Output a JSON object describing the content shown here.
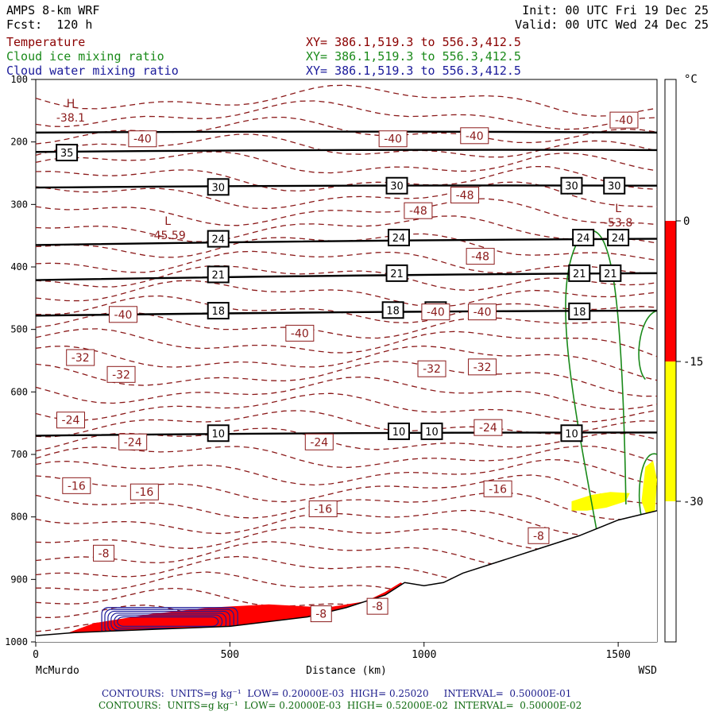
{
  "header": {
    "model": "AMPS 8-km WRF",
    "forecast": "Fcst:  120 h",
    "init": "Init: 00 UTC Fri 19 Dec 25",
    "valid": "Valid: 00 UTC Wed 24 Dec 25"
  },
  "fields": [
    {
      "name": "Temperature",
      "xy": "XY= 386.1,519.3 to 556.3,412.5",
      "color": "#8b0000"
    },
    {
      "name": "Cloud ice mixing ratio",
      "xy": "XY= 386.1,519.3 to 556.3,412.5",
      "color": "#1a8a1a"
    },
    {
      "name": "Cloud water mixing ratio",
      "xy": "XY= 386.1,519.3 to 556.3,412.5",
      "color": "#1a1a9a"
    }
  ],
  "footer": {
    "line1": "CONTOURS:  UNITS=g kg⁻¹  LOW= 0.20000E-03  HIGH= 0.25020     INTERVAL=  0.50000E-01",
    "line2": "CONTOURS:  UNITS=g kg⁻¹  LOW= 0.20000E-03  HIGH= 0.52000E-02  INTERVAL=  0.50000E-02"
  },
  "chart_data": {
    "type": "line",
    "xlabel": "Distance (km)",
    "xlim": [
      0,
      1600
    ],
    "xticks": [
      0,
      500,
      1000,
      1500
    ],
    "x_endpoints": {
      "left": "McMurdo",
      "right": "WSD"
    },
    "ylim": [
      1000,
      100
    ],
    "yticks": [
      100,
      200,
      300,
      400,
      500,
      600,
      700,
      800,
      900,
      1000
    ],
    "colorbar": {
      "unit": "°C",
      "ticks": [
        0,
        -15,
        -30
      ],
      "colors": {
        "above_0": "#ffffff",
        "0_to_-15": "#ff0000",
        "-15_to_-30": "#ffff00",
        "below_-30": "#ffffff"
      }
    },
    "theta_lines": [
      {
        "level": 35,
        "pressure_left": 185,
        "pressure_right": 185
      },
      {
        "level": 35,
        "pressure_left": 216,
        "pressure_right": 213
      },
      {
        "level": 30,
        "pressure_left": 273,
        "pressure_right": 270
      },
      {
        "level": 24,
        "pressure_left": 365,
        "pressure_right": 355
      },
      {
        "level": 21,
        "pressure_left": 421,
        "pressure_right": 410
      },
      {
        "level": 18,
        "pressure_left": 478,
        "pressure_right": 470
      },
      {
        "level": 10,
        "pressure_left": 670,
        "pressure_right": 665
      }
    ],
    "theta_labels": [
      {
        "text": "35",
        "x": 80,
        "p": 217
      },
      {
        "text": "30",
        "x": 470,
        "p": 272
      },
      {
        "text": "30",
        "x": 930,
        "p": 270
      },
      {
        "text": "30",
        "x": 1380,
        "p": 270
      },
      {
        "text": "30",
        "x": 1490,
        "p": 270
      },
      {
        "text": "24",
        "x": 470,
        "p": 355
      },
      {
        "text": "24",
        "x": 935,
        "p": 353
      },
      {
        "text": "24",
        "x": 1410,
        "p": 353
      },
      {
        "text": "24",
        "x": 1500,
        "p": 353
      },
      {
        "text": "21",
        "x": 470,
        "p": 412
      },
      {
        "text": "21",
        "x": 930,
        "p": 410
      },
      {
        "text": "21",
        "x": 1400,
        "p": 410
      },
      {
        "text": "21",
        "x": 1480,
        "p": 410
      },
      {
        "text": "18",
        "x": 470,
        "p": 470
      },
      {
        "text": "18",
        "x": 920,
        "p": 469
      },
      {
        "text": "18",
        "x": 1030,
        "p": 469
      },
      {
        "text": "18",
        "x": 1400,
        "p": 471
      },
      {
        "text": "10",
        "x": 470,
        "p": 666
      },
      {
        "text": "10",
        "x": 935,
        "p": 663
      },
      {
        "text": "10",
        "x": 1020,
        "p": 663
      },
      {
        "text": "10",
        "x": 1380,
        "p": 666
      }
    ],
    "temp_labels": [
      {
        "text": "-40",
        "x": 275,
        "p": 195
      },
      {
        "text": "-40",
        "x": 920,
        "p": 195
      },
      {
        "text": "-40",
        "x": 1130,
        "p": 190
      },
      {
        "text": "-40",
        "x": 1515,
        "p": 165
      },
      {
        "text": "-48",
        "x": 1105,
        "p": 285
      },
      {
        "text": "-48",
        "x": 985,
        "p": 310
      },
      {
        "text": "-48",
        "x": 1145,
        "p": 383
      },
      {
        "text": "-40",
        "x": 225,
        "p": 476
      },
      {
        "text": "-40",
        "x": 680,
        "p": 506
      },
      {
        "text": "-40",
        "x": 1030,
        "p": 472
      },
      {
        "text": "-40",
        "x": 1150,
        "p": 472
      },
      {
        "text": "-32",
        "x": 115,
        "p": 545
      },
      {
        "text": "-32",
        "x": 220,
        "p": 572
      },
      {
        "text": "-32",
        "x": 1020,
        "p": 563
      },
      {
        "text": "-32",
        "x": 1150,
        "p": 560
      },
      {
        "text": "-24",
        "x": 90,
        "p": 645
      },
      {
        "text": "-24",
        "x": 250,
        "p": 680
      },
      {
        "text": "-24",
        "x": 730,
        "p": 680
      },
      {
        "text": "-24",
        "x": 1165,
        "p": 657
      },
      {
        "text": "-16",
        "x": 105,
        "p": 750
      },
      {
        "text": "-16",
        "x": 280,
        "p": 760
      },
      {
        "text": "-16",
        "x": 740,
        "p": 787
      },
      {
        "text": "-16",
        "x": 1190,
        "p": 755
      },
      {
        "text": "-8",
        "x": 175,
        "p": 858
      },
      {
        "text": "-8",
        "x": 1295,
        "p": 830
      },
      {
        "text": "-8",
        "x": 735,
        "p": 955
      },
      {
        "text": "-8",
        "x": 880,
        "p": 943
      }
    ],
    "extrema": [
      {
        "type": "H",
        "value": "-38.1",
        "x": 90,
        "p": 152
      },
      {
        "type": "L",
        "value": "-45.59",
        "x": 340,
        "p": 340
      },
      {
        "type": "L",
        "value": "-53.8",
        "x": 1500,
        "p": 320
      }
    ],
    "terrain": [
      [
        0,
        990
      ],
      [
        100,
        985
      ],
      [
        300,
        980
      ],
      [
        500,
        975
      ],
      [
        700,
        960
      ],
      [
        800,
        945
      ],
      [
        900,
        925
      ],
      [
        950,
        905
      ],
      [
        1000,
        910
      ],
      [
        1050,
        905
      ],
      [
        1100,
        890
      ],
      [
        1200,
        870
      ],
      [
        1300,
        850
      ],
      [
        1400,
        830
      ],
      [
        1500,
        805
      ],
      [
        1600,
        790
      ]
    ]
  }
}
